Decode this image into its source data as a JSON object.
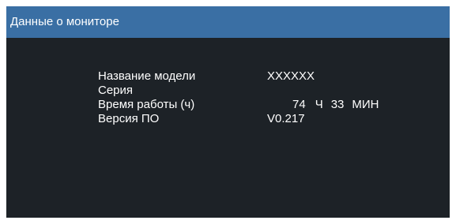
{
  "osd": {
    "title": "Данные о мониторе",
    "colors": {
      "header": "#3a6fa4",
      "panel": "#1d2227",
      "text": "#ffffff"
    }
  },
  "info": {
    "model": {
      "label": "Название модели",
      "value": "XXXXXX"
    },
    "serial": {
      "label": "Серия",
      "value": ""
    },
    "runtime": {
      "label": "Время работы (ч)",
      "hours": "74",
      "hours_unit": "Ч",
      "minutes": "33",
      "minutes_unit": "МИН"
    },
    "firmware": {
      "label": "Версия ПО",
      "value": "V0.217"
    }
  }
}
